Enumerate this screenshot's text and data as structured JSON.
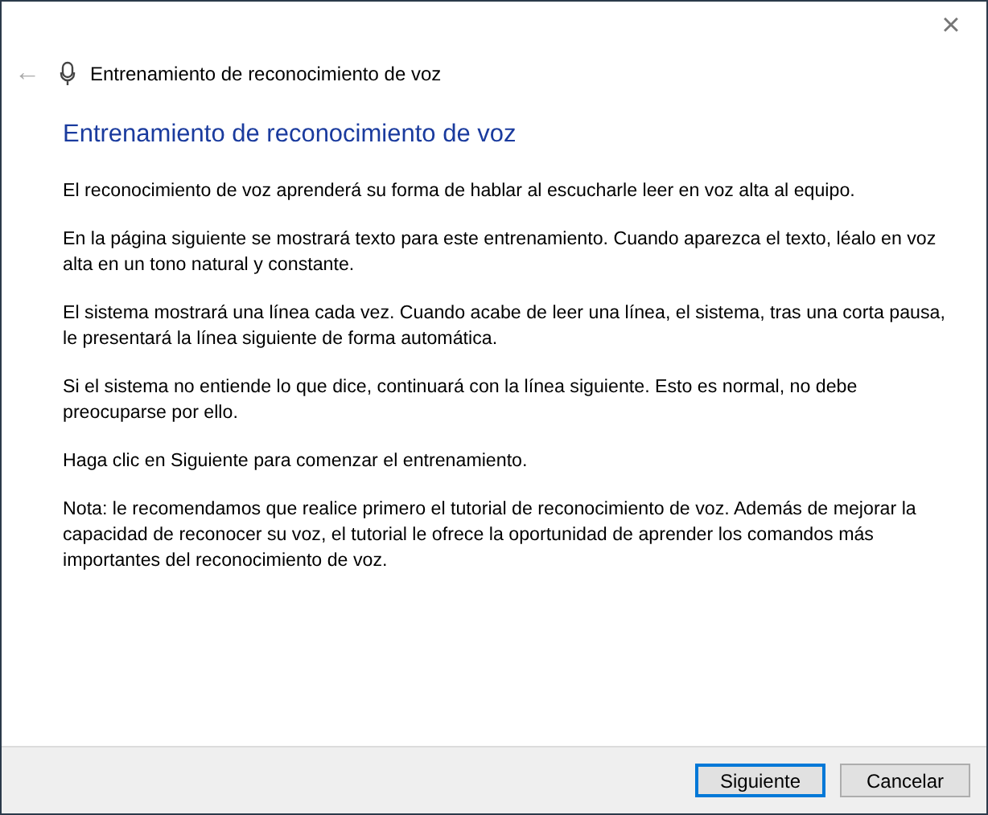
{
  "window": {
    "close": "×"
  },
  "nav": {
    "back": "←",
    "title": "Entrenamiento de reconocimiento de voz"
  },
  "heading": "Entrenamiento de reconocimiento de voz",
  "paragraphs": [
    "El reconocimiento de voz aprenderá su forma de hablar al escucharle leer en voz alta al equipo.",
    "En la página siguiente se mostrará texto para este entrenamiento. Cuando aparezca el texto, léalo en voz alta en un tono natural y constante.",
    "El sistema mostrará una línea cada vez. Cuando acabe de leer una línea, el sistema, tras una corta pausa, le presentará la línea siguiente de forma automática.",
    "Si el sistema no entiende lo que dice, continuará con la línea siguiente. Esto es normal, no debe preocuparse por ello.",
    "Haga clic en Siguiente para comenzar el entrenamiento.",
    "Nota: le recomendamos que realice primero el tutorial de reconocimiento de voz. Además de mejorar la capacidad de reconocer su voz, el tutorial le ofrece la oportunidad de aprender los comandos más importantes del reconocimiento de voz."
  ],
  "buttons": [
    {
      "label": "Siguiente",
      "default": true
    },
    {
      "label": "Cancelar",
      "default": false
    }
  ]
}
